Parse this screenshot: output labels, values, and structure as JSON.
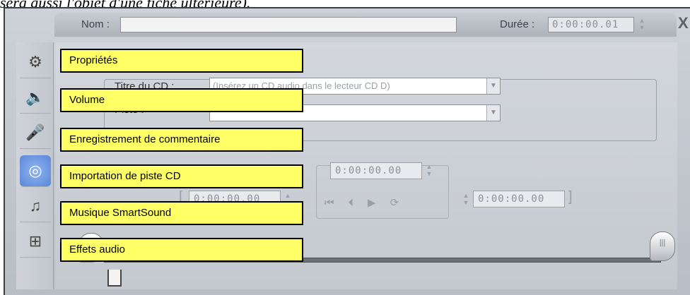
{
  "intro_text": "sera aussi l'objet d'une fiche ultérieure).",
  "header": {
    "name_label": "Nom :",
    "name_value": "",
    "duration_label": "Durée :",
    "duration_value": "0:00:00.01",
    "close_label": "X"
  },
  "sidebar": {
    "tabs": [
      {
        "icon": "properties-icon",
        "glyph": "⚙"
      },
      {
        "icon": "volume-icon",
        "glyph": "🔈"
      },
      {
        "icon": "microphone-icon",
        "glyph": "🎤"
      },
      {
        "icon": "cd-icon",
        "glyph": "◎"
      },
      {
        "icon": "music-note-icon",
        "glyph": "♫"
      },
      {
        "icon": "audio-effects-icon",
        "glyph": "⊞"
      }
    ]
  },
  "panel": {
    "cd_title_label": "Titre du CD :",
    "cd_title_value": "(Insérez un CD audio dans le lecteur CD D)",
    "track_label": "Piste :",
    "track_value": "",
    "time_top": "0:00:00.00",
    "time_left": "0:00:00.00",
    "time_right": "0:00:00.00"
  },
  "callouts": {
    "properties": "Propriétés",
    "volume": "Volume",
    "commentary": "Enregistrement de commentaire",
    "cd_import": "Importation de piste CD",
    "smartsound": "Musique SmartSound",
    "effects": "Effets audio"
  },
  "colors": {
    "callout_bg": "#ffff66",
    "window_bg": "#c4c8cf",
    "active_tab": "#5a86d8"
  }
}
